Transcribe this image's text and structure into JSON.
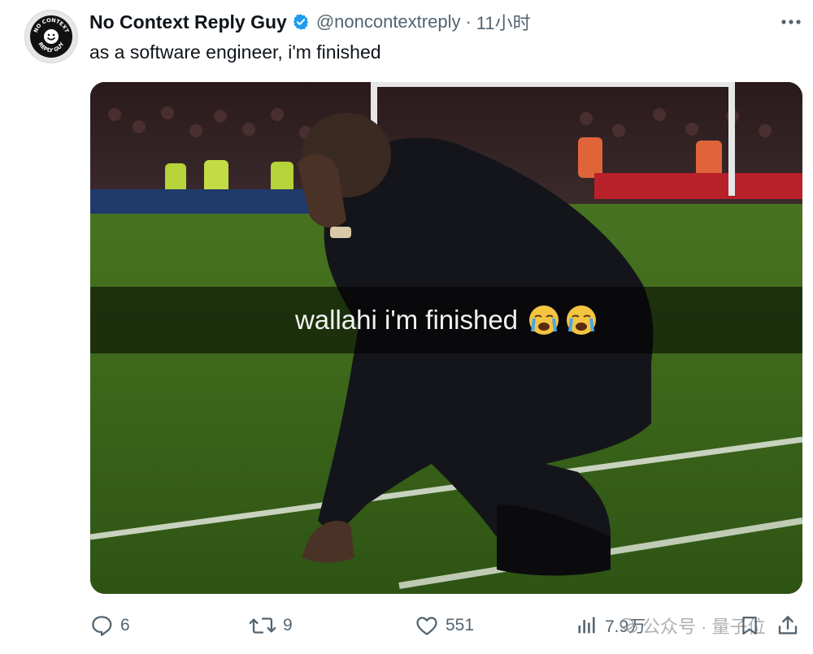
{
  "author": {
    "display_name": "No Context Reply Guy",
    "handle": "@noncontextreply",
    "timestamp": "11小时",
    "avatar_text": "NO CONTEXT REPLY GUY",
    "verified_icon": "verified-badge-icon"
  },
  "tweet": {
    "text": "as a software engineer, i'm finished"
  },
  "media": {
    "caption": "wallahi i'm finished",
    "emojis": "😭😭"
  },
  "actions": {
    "replies": "6",
    "retweets": "9",
    "likes": "551",
    "views": "7.9万"
  },
  "watermark": {
    "text": "公众号 · 量子位"
  },
  "colors": {
    "verified": "#1d9bf0",
    "muted": "#536471",
    "text": "#0f1419"
  }
}
